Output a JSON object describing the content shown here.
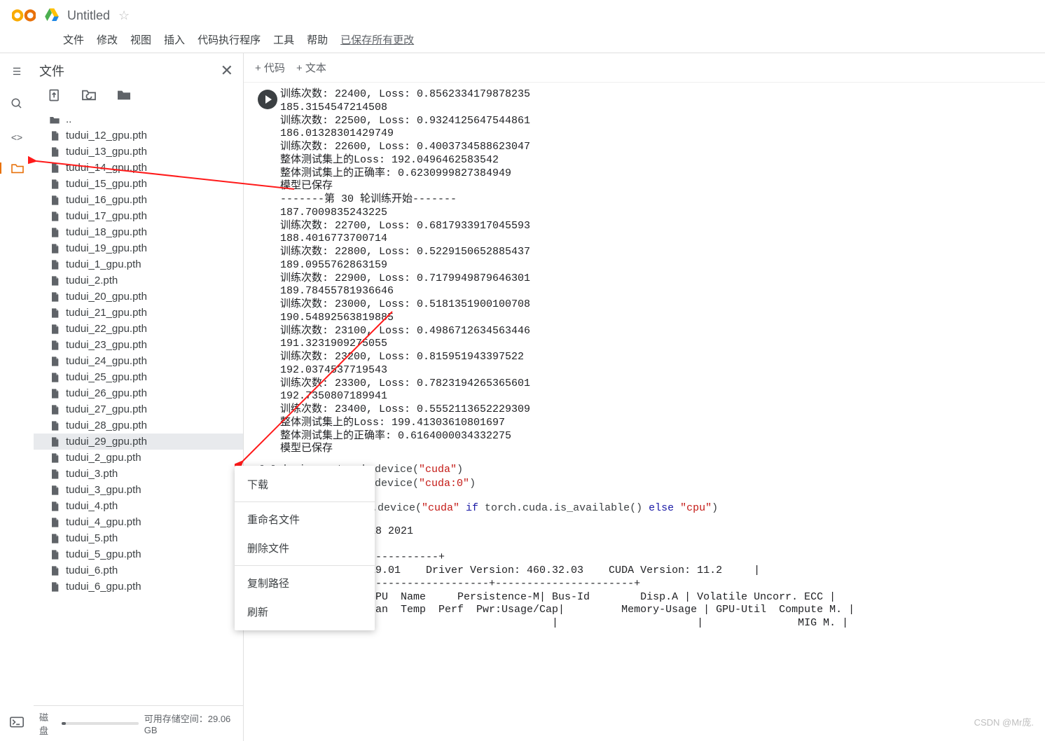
{
  "header": {
    "title": "Untitled"
  },
  "menu": {
    "file": "文件",
    "edit": "修改",
    "view": "视图",
    "insert": "插入",
    "runtime": "代码执行程序",
    "tools": "工具",
    "help": "帮助",
    "saved": "已保存所有更改"
  },
  "sidebar": {
    "title": "文件",
    "parent": "..",
    "files": [
      {
        "name": "tudui_12_gpu.pth",
        "selected": false
      },
      {
        "name": "tudui_13_gpu.pth",
        "selected": false
      },
      {
        "name": "tudui_14_gpu.pth",
        "selected": false
      },
      {
        "name": "tudui_15_gpu.pth",
        "selected": false
      },
      {
        "name": "tudui_16_gpu.pth",
        "selected": false
      },
      {
        "name": "tudui_17_gpu.pth",
        "selected": false
      },
      {
        "name": "tudui_18_gpu.pth",
        "selected": false
      },
      {
        "name": "tudui_19_gpu.pth",
        "selected": false
      },
      {
        "name": "tudui_1_gpu.pth",
        "selected": false
      },
      {
        "name": "tudui_2.pth",
        "selected": false
      },
      {
        "name": "tudui_20_gpu.pth",
        "selected": false
      },
      {
        "name": "tudui_21_gpu.pth",
        "selected": false
      },
      {
        "name": "tudui_22_gpu.pth",
        "selected": false
      },
      {
        "name": "tudui_23_gpu.pth",
        "selected": false
      },
      {
        "name": "tudui_24_gpu.pth",
        "selected": false
      },
      {
        "name": "tudui_25_gpu.pth",
        "selected": false
      },
      {
        "name": "tudui_26_gpu.pth",
        "selected": false
      },
      {
        "name": "tudui_27_gpu.pth",
        "selected": false
      },
      {
        "name": "tudui_28_gpu.pth",
        "selected": false
      },
      {
        "name": "tudui_29_gpu.pth",
        "selected": true
      },
      {
        "name": "tudui_2_gpu.pth",
        "selected": false
      },
      {
        "name": "tudui_3.pth",
        "selected": false
      },
      {
        "name": "tudui_3_gpu.pth",
        "selected": false
      },
      {
        "name": "tudui_4.pth",
        "selected": false
      },
      {
        "name": "tudui_4_gpu.pth",
        "selected": false
      },
      {
        "name": "tudui_5.pth",
        "selected": false
      },
      {
        "name": "tudui_5_gpu.pth",
        "selected": false
      },
      {
        "name": "tudui_6.pth",
        "selected": false
      },
      {
        "name": "tudui_6_gpu.pth",
        "selected": false
      }
    ],
    "disk_label": "磁盘",
    "disk_avail": "可用存储空间：29.06 GB"
  },
  "celltoolbar": {
    "code": "+ 代码",
    "text": "+ 文本"
  },
  "output": "训练次数: 22400, Loss: 0.8562334179878235\n185.3154547214508\n训练次数: 22500, Loss: 0.9324125647544861\n186.01328301429749\n训练次数: 22600, Loss: 0.4003734588623047\n整体测试集上的Loss: 192.0496462583542\n整体测试集上的正确率: 0.6230999827384949\n模型已保存\n-------第 30 轮训练开始-------\n187.7009835243225\n训练次数: 22700, Loss: 0.6817933917045593\n188.4016773700714\n训练次数: 22800, Loss: 0.5229150652885437\n189.0955762863159\n训练次数: 22900, Loss: 0.7179949879646301\n189.78455781936646\n训练次数: 23000, Loss: 0.5181351900100708\n190.54892563819885\n训练次数: 23100, Loss: 0.4986712634563446\n191.3231909275055\n训练次数: 23200, Loss: 0.815951943397522\n192.0374537719543\n训练次数: 23300, Loss: 0.7823194265365601\n192.7350807189941\n训练次数: 23400, Loss: 0.5552113652229309\n整体测试集上的Loss: 199.41303610801697\n整体测试集上的正确率: 0.6164000034332275\n模型已保存",
  "code1": {
    "l1_pre": "device = torch.device(",
    "l1_str": "\"cuda\"",
    "l1_post": ")",
    "l2_pre": "device = torch.device(",
    "l2_str": "\"cuda:0\"",
    "l2_post": ")"
  },
  "code2": {
    "prefix": ".device(",
    "s1": "\"cuda\"",
    " if_": " if ",
    "cond": "torch.cuda.is_available() ",
    "else_": "else ",
    "s2": "\"cpu\"",
    "post": ")"
  },
  "nvsmi": "46:18 2021\n\n--------------+\n65.19.01    Driver Version: 460.32.03    CUDA Version: 11.2     |\n----------------------+----------------------+\n|  GPU  Name     Persistence-M| Bus-Id        Disp.A | Volatile Uncorr. ECC |\n|  Fan  Temp  Perf  Pwr:Usage/Cap|         Memory-Usage | GPU-Util  Compute M. |\n|                               |                      |               MIG M. |",
  "context": {
    "download": "下载",
    "rename": "重命名文件",
    "delete": "删除文件",
    "copy": "复制路径",
    "refresh": "刷新"
  },
  "watermark": "CSDN @Mr庞."
}
